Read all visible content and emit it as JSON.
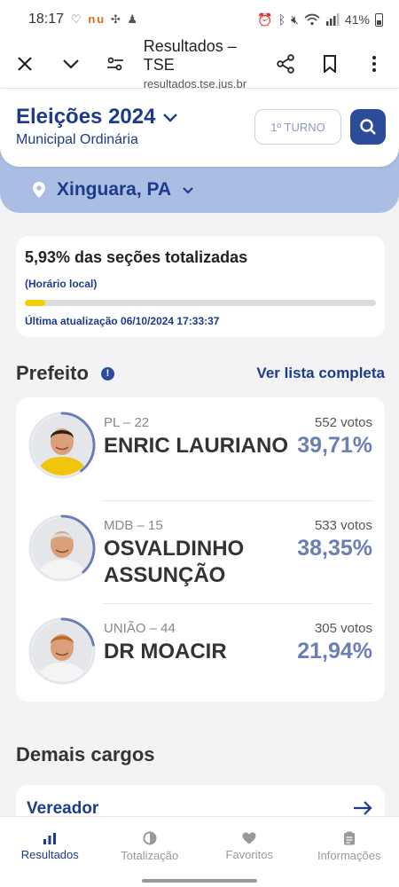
{
  "status_bar": {
    "time": "18:17",
    "apps": "nu",
    "battery": "41%"
  },
  "browser": {
    "title": "Resultados – TSE",
    "url": "resultados.tse.jus.br"
  },
  "header": {
    "title": "Eleições 2024",
    "subtitle": "Municipal Ordinária",
    "turno": "1º TURNO",
    "city": "Xinguara, PA"
  },
  "progress": {
    "title": "5,93% das seções totalizadas",
    "local": "(Horário local)",
    "fraction": 0.0593,
    "updated": "Última atualização 06/10/2024 17:33:37"
  },
  "prefeito": {
    "title": "Prefeito",
    "info": "!",
    "see_all": "Ver lista completa",
    "candidates": [
      {
        "party": "PL – 22",
        "name": "ENRIC LAURIANO",
        "votes": "552 votos",
        "pct": "39,71%",
        "share": 0.3971,
        "shirt": "#f1c40f",
        "hair": "#2e2217"
      },
      {
        "party": "MDB – 15",
        "name": "OSVALDINHO ASSUNÇÃO",
        "votes": "533 votos",
        "pct": "38,35%",
        "share": 0.3835,
        "shirt": "#f4f4f4",
        "hair": "#d9d9d9"
      },
      {
        "party": "UNIÃO – 44",
        "name": "DR MOACIR",
        "votes": "305 votos",
        "pct": "21,94%",
        "share": 0.2194,
        "shirt": "#f4f4f4",
        "hair": "#b86b2a"
      }
    ]
  },
  "demais": {
    "title": "Demais cargos",
    "first": "Vereador"
  },
  "nav": [
    {
      "label": "Resultados",
      "icon": "bar-chart-icon"
    },
    {
      "label": "Totalização",
      "icon": "pie-icon"
    },
    {
      "label": "Favoritos",
      "icon": "heart-icon"
    },
    {
      "label": "Informações",
      "icon": "clipboard-icon"
    }
  ],
  "colors": {
    "brand": "#1d3b8b",
    "accent_blue": "#2a4c9a",
    "band": "#aabee3",
    "progress": "#f2cf00",
    "pct": "#6b7fb5"
  }
}
